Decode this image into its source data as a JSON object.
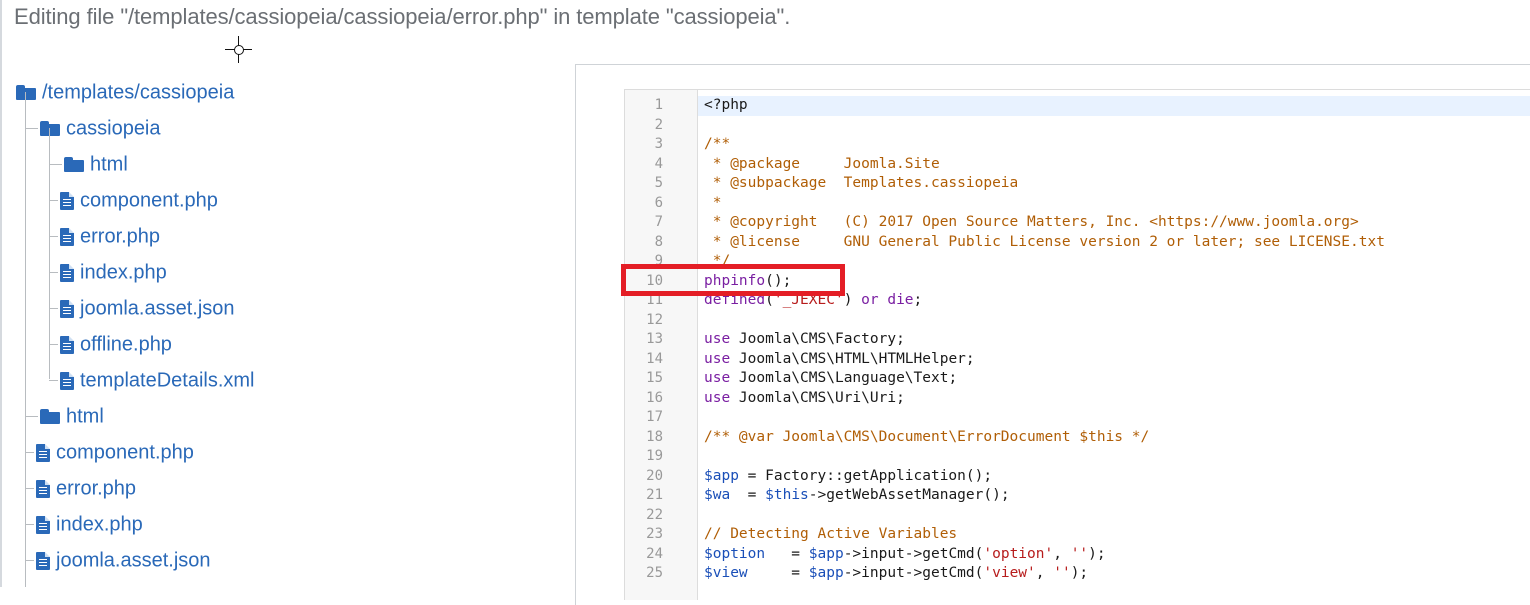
{
  "heading": "Editing file \"/templates/cassiopeia/cassiopeia/error.php\" in template \"cassiopeia\".",
  "tree": [
    {
      "label": "/templates/cassiopeia",
      "type": "folder",
      "level": 0
    },
    {
      "label": "cassiopeia",
      "type": "folder",
      "level": 1
    },
    {
      "label": "html",
      "type": "folder",
      "level": 2
    },
    {
      "label": "component.php",
      "type": "file",
      "level": 2
    },
    {
      "label": "error.php",
      "type": "file",
      "level": 2
    },
    {
      "label": "index.php",
      "type": "file",
      "level": 2
    },
    {
      "label": "joomla.asset.json",
      "type": "file",
      "level": 2
    },
    {
      "label": "offline.php",
      "type": "file",
      "level": 2
    },
    {
      "label": "templateDetails.xml",
      "type": "file",
      "level": 2
    },
    {
      "label": "html",
      "type": "folder",
      "level": 1
    },
    {
      "label": "component.php",
      "type": "file",
      "level": 1
    },
    {
      "label": "error.php",
      "type": "file",
      "level": 1
    },
    {
      "label": "index.php",
      "type": "file",
      "level": 1
    },
    {
      "label": "joomla.asset.json",
      "type": "file",
      "level": 1
    }
  ],
  "editor": {
    "highlighted_line": 10,
    "lines": [
      {
        "n": "1",
        "t": "<?php"
      },
      {
        "n": "2",
        "t": ""
      },
      {
        "n": "3",
        "t": "/**"
      },
      {
        "n": "4",
        "t": " * @package     Joomla.Site"
      },
      {
        "n": "5",
        "t": " * @subpackage  Templates.cassiopeia"
      },
      {
        "n": "6",
        "t": " *"
      },
      {
        "n": "7",
        "t": " * @copyright   (C) 2017 Open Source Matters, Inc. <https://www.joomla.org>"
      },
      {
        "n": "8",
        "t": " * @license     GNU General Public License version 2 or later; see LICENSE.txt"
      },
      {
        "n": "9",
        "t": " */"
      },
      {
        "n": "10",
        "t": "phpinfo();"
      },
      {
        "n": "11",
        "t": "defined('_JEXEC') or die;"
      },
      {
        "n": "12",
        "t": ""
      },
      {
        "n": "13",
        "t": "use Joomla\\CMS\\Factory;"
      },
      {
        "n": "14",
        "t": "use Joomla\\CMS\\HTML\\HTMLHelper;"
      },
      {
        "n": "15",
        "t": "use Joomla\\CMS\\Language\\Text;"
      },
      {
        "n": "16",
        "t": "use Joomla\\CMS\\Uri\\Uri;"
      },
      {
        "n": "17",
        "t": ""
      },
      {
        "n": "18",
        "t": "/** @var Joomla\\CMS\\Document\\ErrorDocument $this */"
      },
      {
        "n": "19",
        "t": ""
      },
      {
        "n": "20",
        "t": "$app = Factory::getApplication();"
      },
      {
        "n": "21",
        "t": "$wa  = $this->getWebAssetManager();"
      },
      {
        "n": "22",
        "t": ""
      },
      {
        "n": "23",
        "t": "// Detecting Active Variables"
      },
      {
        "n": "24",
        "t": "$option   = $app->input->getCmd('option', '');"
      },
      {
        "n": "25",
        "t": "$view     = $app->input->getCmd('view', '');"
      }
    ]
  },
  "colors": {
    "link": "#2a69b8",
    "highlight_box": "#e41e26",
    "comment": "#b05e06",
    "keyword": "#7a1fa2",
    "variable": "#1a4fb8",
    "string": "#b71c1c"
  }
}
